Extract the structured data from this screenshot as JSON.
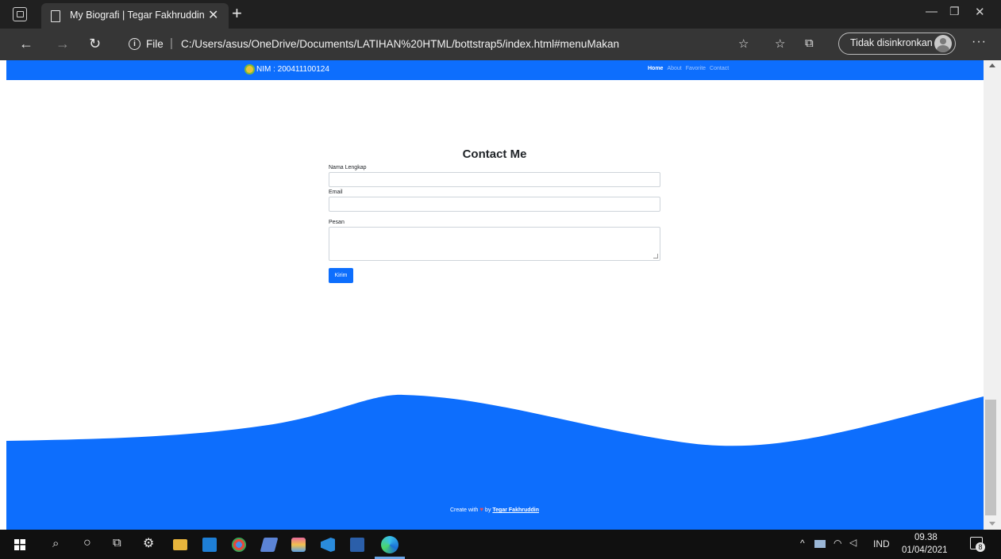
{
  "browser": {
    "tab_title": "My Biografi | Tegar Fakhruddin",
    "url_scheme": "File",
    "url": "C:/Users/asus/OneDrive/Documents/LATIHAN%20HTML/bottstrap5/index.html#menuMakan",
    "sync_label": "Tidak disinkronkan"
  },
  "navbar": {
    "brand": "NIM : 200411100124",
    "links": [
      "Home",
      "About",
      "Favorite",
      "Contact"
    ]
  },
  "contact": {
    "title": "Contact Me",
    "name_label": "Nama Lengkap",
    "email_label": "Email",
    "message_label": "Pesan",
    "submit_label": "Kirim"
  },
  "footer": {
    "prefix": "Create with",
    "by": "by",
    "author": "Tegar Fakhruddin"
  },
  "taskbar": {
    "language": "IND",
    "time": "09.38",
    "date": "01/04/2021",
    "notification_count": "8"
  },
  "colors": {
    "primary": "#0d6efd",
    "heart": "#e74c5b"
  }
}
